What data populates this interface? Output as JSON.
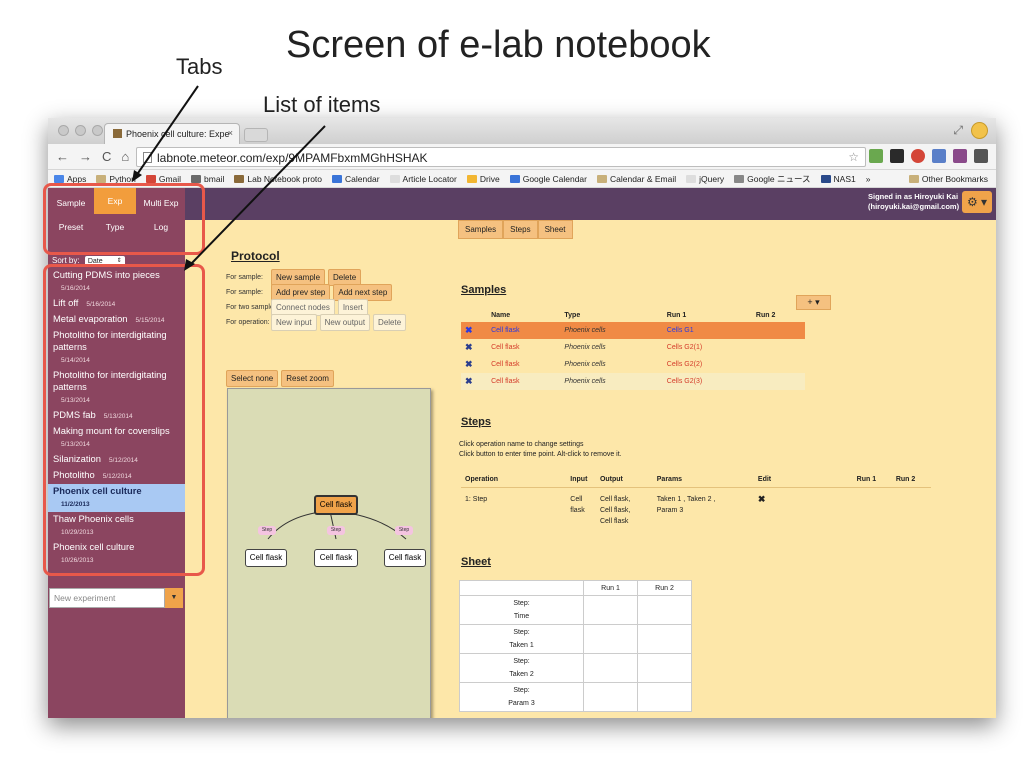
{
  "slide": {
    "title": "Screen of e-lab notebook",
    "ann_tabs": "Tabs",
    "ann_list": "List of items"
  },
  "browser": {
    "tab_title": "Phoenix cell culture: Expe",
    "tab_close": "×",
    "url": "labnote.meteor.com/exp/9MPAMFbxmMGhHSHAK",
    "nav": [
      "←",
      "→",
      "C",
      "⌂"
    ],
    "bookmarks": [
      {
        "label": "Apps",
        "color": "#4a86e8"
      },
      {
        "label": "Python",
        "color": "#c8b07a"
      },
      {
        "label": "Gmail",
        "color": "#d44638"
      },
      {
        "label": "bmail",
        "color": "#6a6a6a"
      },
      {
        "label": "Lab Notebook proto",
        "color": "#8a6a3a"
      },
      {
        "label": "Calendar",
        "color": "#3a74d8"
      },
      {
        "label": "Article Locator",
        "color": "#dddddd"
      },
      {
        "label": "Drive",
        "color": "#f2b632"
      },
      {
        "label": "Google Calendar",
        "color": "#3a74d8"
      },
      {
        "label": "Calendar & Email",
        "color": "#c8b07a"
      },
      {
        "label": "jQuery",
        "color": "#dddddd"
      },
      {
        "label": "Google ニュース",
        "color": "#888888"
      },
      {
        "label": "NAS1",
        "color": "#2a4a8a"
      },
      {
        "label": "»",
        "color": ""
      }
    ],
    "other_bookmarks": "Other Bookmarks"
  },
  "app": {
    "signed_line1": "Signed in as Hiroyuki Kai",
    "signed_line2": "(hiroyuki.kai@gmail.com)",
    "gear_label": "⚙ ▾",
    "sidebar_tabs": {
      "sample": "Sample",
      "exp": "Exp",
      "multi_exp": "Multi Exp",
      "preset": "Preset",
      "type": "Type",
      "log": "Log"
    },
    "sort_label": "Sort by:",
    "sort_value": "Date",
    "items": [
      {
        "name": "Cutting PDMS into pieces",
        "date": "5/16/2014"
      },
      {
        "name": "Lift off",
        "date": "5/16/2014"
      },
      {
        "name": "Metal evaporation",
        "date": "5/15/2014"
      },
      {
        "name": "Photolitho for interdigitating patterns",
        "date": "5/14/2014"
      },
      {
        "name": "Photolitho for interdigitating patterns",
        "date": "5/13/2014"
      },
      {
        "name": "PDMS fab",
        "date": "5/13/2014"
      },
      {
        "name": "Making mount for coverslips",
        "date": "5/13/2014"
      },
      {
        "name": "Silanization",
        "date": "5/12/2014"
      },
      {
        "name": "Photolitho",
        "date": "5/12/2014"
      },
      {
        "name": "Phoenix cell culture",
        "date": "11/2/2013"
      },
      {
        "name": "Thaw Phoenix cells",
        "date": "10/29/2013"
      },
      {
        "name": "Phoenix cell culture",
        "date": "10/26/2013"
      }
    ],
    "new_exp_placeholder": "New experiment",
    "top_buttons": [
      "Samples",
      "Steps",
      "Sheet"
    ],
    "protocol": {
      "title": "Protocol",
      "rows": [
        {
          "label": "For sample:",
          "buttons": [
            "New sample",
            "Delete"
          ]
        },
        {
          "label": "For sample:",
          "buttons": [
            "Add prev step",
            "Add next step"
          ]
        },
        {
          "label": "For two samples:",
          "buttons": [
            "Connect nodes",
            "Insert"
          ]
        },
        {
          "label": "For operation:",
          "buttons": [
            "New input",
            "New output",
            "Delete"
          ]
        }
      ],
      "select_none": "Select none",
      "reset_zoom": "Reset zoom",
      "graph": {
        "main_node": "Cell flask",
        "step": "Step",
        "child_node": "Cell flask"
      }
    },
    "samples": {
      "title": "Samples",
      "headers": [
        "",
        "Name",
        "Type",
        "Run 1",
        "Run 2"
      ],
      "rows": [
        [
          "✖",
          "Cell flask",
          "Phoenix cells",
          "Cells G1",
          ""
        ],
        [
          "✖",
          "Cell flask",
          "Phoenix cells",
          "Cells G2(1)",
          ""
        ],
        [
          "✖",
          "Cell flask",
          "Phoenix cells",
          "Cells G2(2)",
          ""
        ],
        [
          "✖",
          "Cell flask",
          "Phoenix cells",
          "Cells G2(3)",
          ""
        ]
      ],
      "add_button": "+ ▾"
    },
    "steps": {
      "title": "Steps",
      "help1": "Click operation name to change settings",
      "help2": "Click button to enter time point. Alt-click to remove it.",
      "headers": [
        "Operation",
        "Input",
        "Output",
        "Params",
        "Edit",
        "Run 1",
        "Run 2"
      ],
      "row": {
        "operation": "1:  Step",
        "input": [
          "Cell",
          "flask"
        ],
        "output": [
          "Cell flask,",
          "Cell flask,",
          "Cell flask"
        ],
        "params": [
          "Taken 1 , Taken 2 ,",
          "Param 3"
        ],
        "edit": "✖"
      }
    },
    "sheet": {
      "title": "Sheet",
      "headers": [
        "",
        "Run 1",
        "Run 2"
      ],
      "rows": [
        [
          "Step:",
          "Time"
        ],
        [
          "Step:",
          "Taken 1"
        ],
        [
          "Step:",
          "Taken 2"
        ],
        [
          "Step:",
          "Param 3"
        ]
      ]
    }
  }
}
